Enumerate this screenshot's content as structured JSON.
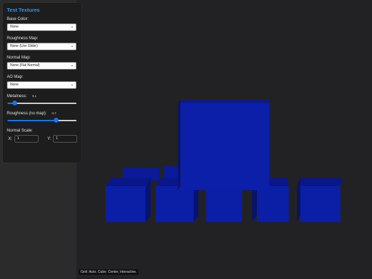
{
  "panel": {
    "title": "Test Textures",
    "base_color": {
      "label": "Base Color:",
      "value": "None"
    },
    "roughness_map": {
      "label": "Roughness Map:",
      "value": "None (Use Slider)"
    },
    "normal_map": {
      "label": "Normal Map:",
      "value": "None (Flat Normal)"
    },
    "ao_map": {
      "label": "AO Map:",
      "value": "None"
    },
    "metalness": {
      "label": "Metalness:",
      "value": "0.1",
      "level": 0.1
    },
    "roughness": {
      "label": "Roughness (no map):",
      "value": "0.7",
      "level": 0.7
    },
    "normal_scale": {
      "label": "Normal Scale:",
      "x_label": "X:",
      "x_value": "1",
      "y_label": "Y:",
      "y_value": "1"
    }
  },
  "status_text": "Grid: Auto. Cube: Center, interactive.",
  "colors": {
    "accent": "#2e9bf0",
    "cube_front": "#0b1fa8",
    "cube_top": "#0c1990",
    "cube_side": "#08146e"
  }
}
